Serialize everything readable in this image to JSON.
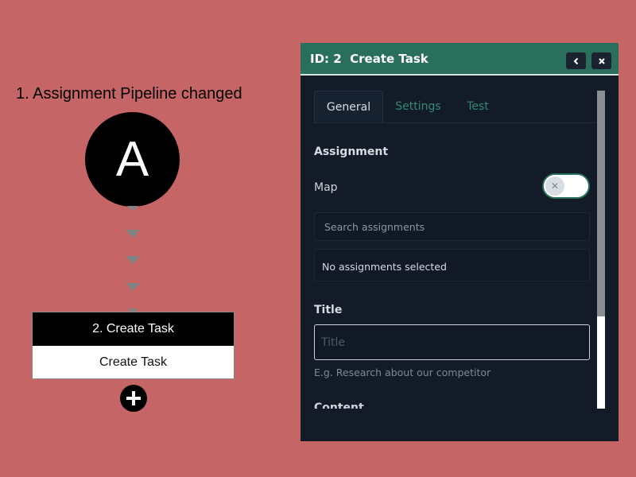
{
  "workflow": {
    "trigger": {
      "title": "1. Assignment Pipeline changed",
      "letter": "A"
    },
    "step": {
      "header": "2. Create Task",
      "body": "Create Task"
    },
    "add_icon": "plus-icon"
  },
  "panel": {
    "title": "ID: 2  Create Task",
    "header_buttons": {
      "back_icon": "chevron-left-icon",
      "close_icon": "close-icon"
    },
    "tabs": [
      {
        "label": "General",
        "active": true
      },
      {
        "label": "Settings",
        "active": false
      },
      {
        "label": "Test",
        "active": false
      }
    ],
    "assignment": {
      "section_label": "Assignment",
      "map_label": "Map",
      "map_toggle_on": false,
      "search_placeholder": "Search assignments",
      "empty_text": "No assignments selected"
    },
    "title_field": {
      "label": "Title",
      "placeholder": "Title",
      "value": "",
      "hint": "E.g. Research about our competitor"
    },
    "content_label": "Content"
  },
  "colors": {
    "background": "#c66566",
    "panel": "#131a28",
    "accent": "#2a6e5c",
    "tab_inactive": "#2f8c73"
  }
}
